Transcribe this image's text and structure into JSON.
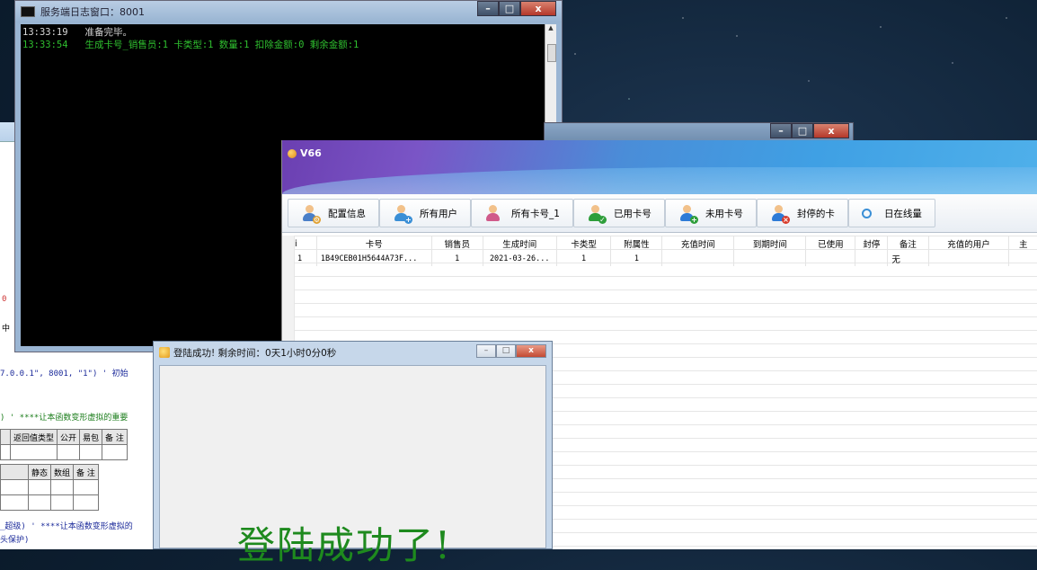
{
  "console": {
    "title": "服务端日志窗口：8001",
    "lines": [
      {
        "time": "13:33:19",
        "text": "准备完毕。"
      },
      {
        "time": "13:33:54",
        "text": "生成卡号_销售员:1 卡类型:1 数量:1 扣除金额:0 剩余金额:1"
      }
    ]
  },
  "ide": {
    "code1": "7.0.0.1\", 8001, \"1\") ' 初始",
    "code2": ") ' ****让本函数变形虚拟的重要",
    "code3": "_超级) ' ****让本函数变形虚拟的",
    "code4": "头保护)",
    "frag1": "0",
    "frag2": "中",
    "table1": [
      "返回值类型",
      "公开",
      "易包",
      "备 注"
    ],
    "table2": [
      "静态",
      "数组",
      "备 注"
    ]
  },
  "app": {
    "title": "V66",
    "toolbar": [
      {
        "label": "配置信息",
        "icon": "config-user-icon",
        "color": "#e0a030"
      },
      {
        "label": "所有用户",
        "icon": "all-users-icon",
        "color": "#3a8fd6"
      },
      {
        "label": "所有卡号_1",
        "icon": "all-cards-icon",
        "color": "#d05a8a"
      },
      {
        "label": "已用卡号",
        "icon": "used-card-icon",
        "color": "#2e9e3a"
      },
      {
        "label": "未用卡号",
        "icon": "unused-card-icon",
        "color": "#2e9e3a"
      },
      {
        "label": "封停的卡",
        "icon": "banned-card-icon",
        "color": "#d83b2a"
      },
      {
        "label": "日在线量",
        "icon": "search-icon",
        "color": "#3a8fd6"
      }
    ],
    "columns": [
      "i",
      "卡号",
      "销售员",
      "生成时间",
      "卡类型",
      "附属性",
      "充值时间",
      "到期时间",
      "已使用",
      "封停",
      "备注",
      "充值的用户",
      "主"
    ],
    "rows": [
      [
        "1",
        "1B49CEB01H5644A73F...",
        "1",
        "2021-03-26...",
        "1",
        "1",
        "",
        "",
        "",
        "",
        "无",
        "",
        ""
      ]
    ]
  },
  "popup": {
    "title": "登陆成功! 剩余时间：0天1小时0分0秒",
    "message": "登陆成功了!"
  }
}
